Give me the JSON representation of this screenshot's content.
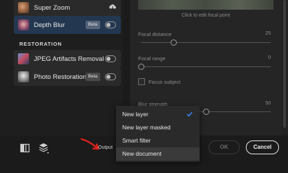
{
  "filters": {
    "items": [
      {
        "label": "Super Zoom",
        "icon": "cloud-download-icon"
      },
      {
        "label": "Depth Blur",
        "badge": "Beta"
      }
    ]
  },
  "restoration": {
    "header": "RESTORATION",
    "items": [
      {
        "label": "JPEG Artifacts Removal"
      },
      {
        "label": "Photo Restoration",
        "badge": "Beta"
      }
    ]
  },
  "preview": {
    "caption": "Click to edit focal point"
  },
  "controls": {
    "focal_distance": {
      "label": "Focal distance",
      "value": "25",
      "level": 0.25
    },
    "focal_range": {
      "label": "Focal range",
      "value": "0",
      "level": 0
    },
    "focus_subject": {
      "label": "Focus subject",
      "checked": false
    },
    "blur_strength": {
      "label": "Blur strength",
      "value": "50",
      "level": 0.5
    }
  },
  "footer": {
    "output_label": "Output",
    "ok_label": "OK",
    "cancel_label": "Cancel"
  },
  "output_menu": {
    "items": [
      "New layer",
      "New layer masked",
      "Smart filter",
      "New document"
    ],
    "selected_index": 0,
    "hover_index": 3
  },
  "colors": {
    "selected_row": "#233750",
    "check_accent": "#3b8cff",
    "arrow_red": "#e0201b"
  }
}
